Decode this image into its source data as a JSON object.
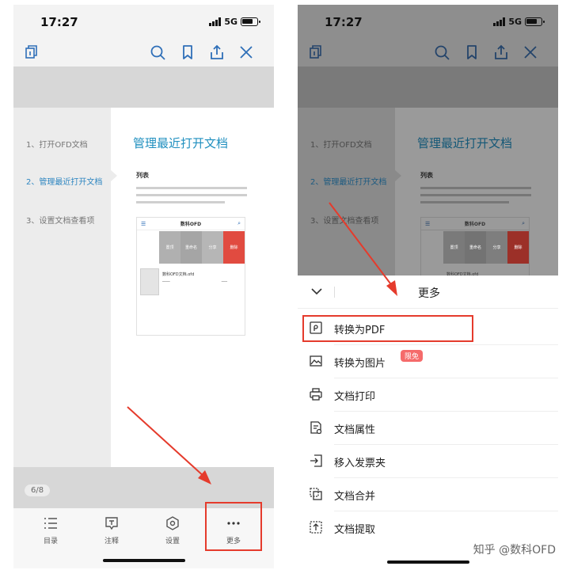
{
  "left": {
    "status": {
      "time": "17:27",
      "network": "5G"
    },
    "toc": [
      "1、打开OFD文档",
      "2、管理最近打开文档",
      "3、设置文档查看项"
    ],
    "content": {
      "title": "管理最近打开文档",
      "subtitle": "列表",
      "mini": {
        "title": "数科OFD",
        "actions": [
          "置顶",
          "重命名",
          "分享",
          "删除"
        ],
        "file_name": "数科OFD文档.ofd"
      }
    },
    "page": "6/8",
    "tabs": [
      "目录",
      "注释",
      "设置",
      "更多"
    ]
  },
  "right": {
    "status": {
      "time": "17:27",
      "network": "5G"
    },
    "sheet_title": "更多",
    "menu": [
      {
        "label": "转换为PDF",
        "icon": "pdf-convert-icon"
      },
      {
        "label": "转换为图片",
        "icon": "image-convert-icon",
        "badge": "限免"
      },
      {
        "label": "文档打印",
        "icon": "printer-icon"
      },
      {
        "label": "文档属性",
        "icon": "document-properties-icon"
      },
      {
        "label": "移入发票夹",
        "icon": "move-to-folder-icon"
      },
      {
        "label": "文档合并",
        "icon": "merge-icon"
      },
      {
        "label": "文档提取",
        "icon": "extract-icon"
      }
    ]
  },
  "watermark": "知乎 @数科OFD",
  "colors": {
    "accent": "#2f6fb8",
    "highlight": "#e53b2c",
    "title": "#1f8fbf",
    "badge": "#f56b6b"
  }
}
